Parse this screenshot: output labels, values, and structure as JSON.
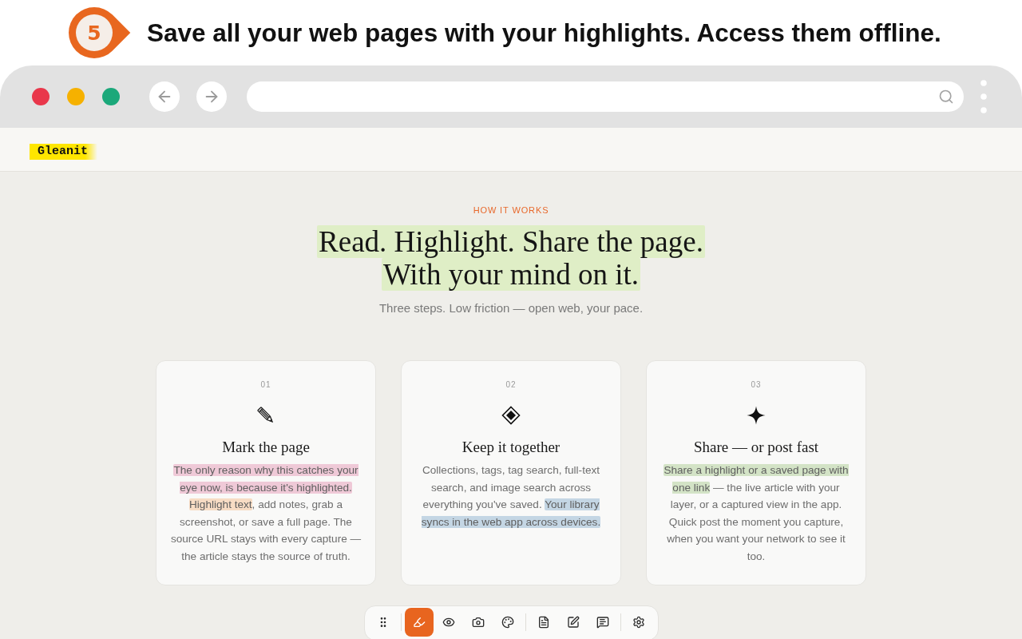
{
  "banner": {
    "step": "5",
    "title": "Save all your web pages with your highlights. Access them offline."
  },
  "browser": {
    "window_controls": [
      {
        "color": "#e9374b"
      },
      {
        "color": "#f6b100"
      },
      {
        "color": "#1ba87a"
      }
    ],
    "page": {
      "logo": "Gleanit",
      "eyebrow": "HOW IT WORKS",
      "headline_lines": [
        "Read. Highlight. Share the page.",
        "With your mind on it."
      ],
      "subtitle": "Three steps. Low friction — open web, your pace.",
      "steps": [
        {
          "number": "01",
          "title": "Mark the page",
          "body": [
            {
              "text": "The only reason why this catches your eye now, is because it's highlighted. ",
              "color": "#efc9d7"
            },
            {
              "text": "Highlight text",
              "color": "#f7dcc4"
            },
            {
              "text": ", add notes, grab a screenshot, or save a full page. The source URL stays with every capture — the article stays the source of truth."
            }
          ]
        },
        {
          "number": "02",
          "title": "Keep it together",
          "body": [
            {
              "text": "Collections, tags, tag search, full-text search, and image search across everything you've saved. "
            },
            {
              "text": "Your library syncs in the web app across devices.",
              "color": "#c4d6e4"
            }
          ]
        },
        {
          "number": "03",
          "title": "Share — or post fast",
          "body": [
            {
              "text": "Share a highlight or a saved page with one link",
              "color": "#d3e3c6"
            },
            {
              "text": " — the live article with your layer, or a captured view in the app. Quick post the moment you capture, when you want your network to see it too."
            }
          ]
        }
      ],
      "toolbar": {
        "groups": [
          {
            "tools": [
              {
                "kind": "grip",
                "selected": false
              }
            ]
          },
          {
            "tools": [
              {
                "kind": "highlighter",
                "selected": true
              },
              {
                "kind": "eye",
                "selected": false
              },
              {
                "kind": "camera",
                "selected": false
              },
              {
                "kind": "palette",
                "selected": false
              }
            ]
          },
          {
            "tools": [
              {
                "kind": "document",
                "selected": false
              },
              {
                "kind": "edit",
                "selected": false
              },
              {
                "kind": "comment",
                "selected": false
              }
            ]
          },
          {
            "tools": [
              {
                "kind": "settings",
                "selected": false
              }
            ]
          }
        ]
      }
    }
  }
}
